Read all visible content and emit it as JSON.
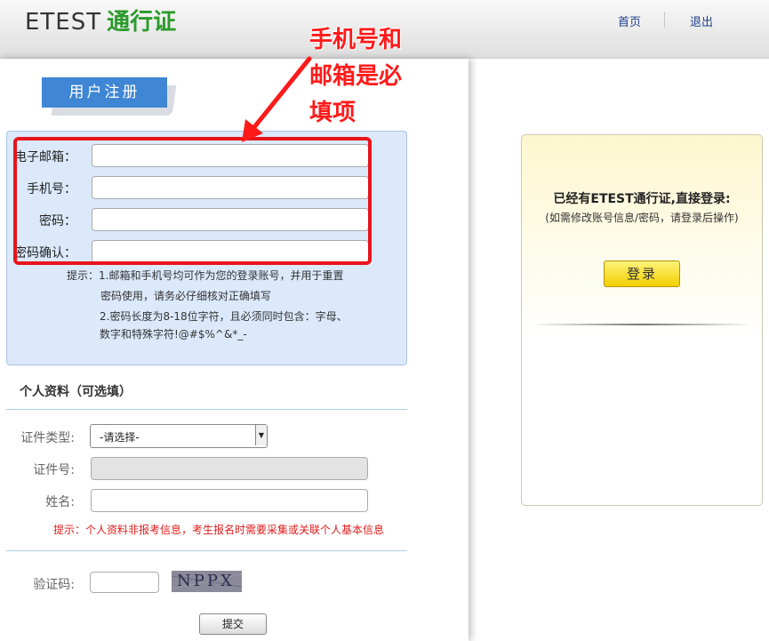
{
  "header": {
    "brand_main": "ETEST",
    "brand_sub": "通行证",
    "nav_home": "首页",
    "nav_logout": "退出"
  },
  "register": {
    "tab_label": "用户注册",
    "fields": {
      "email_label": "电子邮箱：",
      "phone_label": "手机号：",
      "password_label": "密码：",
      "confirm_label": "密码确认："
    },
    "hints": {
      "line1": "提示：1.邮箱和手机号均可作为您的登录账号，并用于重置",
      "line2": "密码使用，请务必仔细核对正确填写",
      "line3": "2.密码长度为8-18位字符，且必须同时包含：字母、",
      "line4": "数字和特殊字符!@#$%^&*_-"
    }
  },
  "annotation": {
    "line1": "手机号和",
    "line2": "邮箱是必",
    "line3": "填项",
    "color": "#ff1a1a"
  },
  "profile": {
    "section_title": "个人资料（可选填）",
    "id_type_label": "证件类型:",
    "id_type_value": "-请选择-",
    "id_number_label": "证件号:",
    "name_label": "姓名:",
    "hint": "提示：个人资料非报考信息，考生报名时需要采集或关联个人基本信息"
  },
  "captcha": {
    "label": "验证码:",
    "image_text": "NPPX"
  },
  "submit_label": "提交",
  "login": {
    "title": "已经有ETEST通行证,直接登录:",
    "subtitle": "(如需修改账号信息/密码，请登录后操作)",
    "button": "登录"
  },
  "colors": {
    "brand_green": "#2a9a2a",
    "tab_blue": "#3f86d4",
    "form_bg": "#dbe9fb",
    "highlight_red": "#e8141c",
    "login_button": "#f2cf00"
  }
}
